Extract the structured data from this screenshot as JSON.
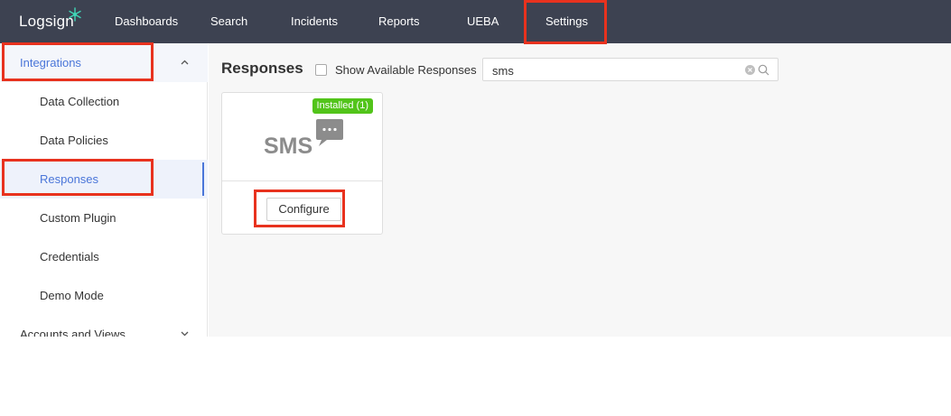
{
  "brand": {
    "logo_text": "Logsign"
  },
  "topnav": {
    "items": [
      {
        "label": "Dashboards",
        "active": false
      },
      {
        "label": "Search",
        "active": false
      },
      {
        "label": "Incidents",
        "active": false
      },
      {
        "label": "Reports",
        "active": false
      },
      {
        "label": "UEBA",
        "active": false
      },
      {
        "label": "Settings",
        "active": true
      }
    ]
  },
  "sidebar": {
    "groups": [
      {
        "label": "Integrations",
        "expanded": true,
        "items": [
          {
            "label": "Data Collection",
            "active": false
          },
          {
            "label": "Data Policies",
            "active": false
          },
          {
            "label": "Responses",
            "active": true
          },
          {
            "label": "Custom Plugin",
            "active": false
          },
          {
            "label": "Credentials",
            "active": false
          },
          {
            "label": "Demo Mode",
            "active": false
          }
        ]
      },
      {
        "label": "Accounts and Views",
        "expanded": false
      }
    ]
  },
  "main": {
    "title": "Responses",
    "show_available": {
      "label": "Show Available Responses",
      "checked": false
    },
    "search": {
      "value": "sms"
    },
    "cards": [
      {
        "logo_text": "SMS",
        "badge": "Installed (1)",
        "button_label": "Configure"
      }
    ]
  },
  "icons": {
    "logo_mark": "logsign-snowflake-icon",
    "expand": "chevron-up-icon",
    "collapse": "chevron-down-icon",
    "clear": "clear-icon",
    "search": "search-icon",
    "chat": "chat-bubble-icon"
  },
  "colors": {
    "topnav_bg": "#3d4251",
    "accent": "#4a76d9",
    "badge_green": "#52c41a",
    "highlight_red": "#e8321e"
  }
}
